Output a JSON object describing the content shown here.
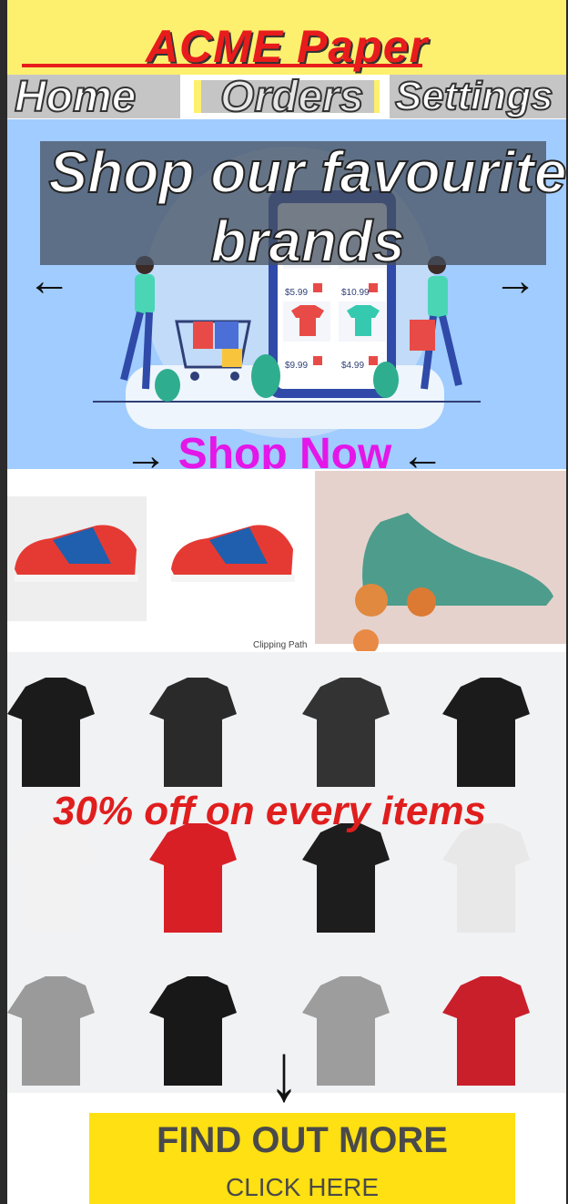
{
  "header": {
    "title": "ACME  Paper"
  },
  "nav": [
    {
      "label": "Home"
    },
    {
      "label": "Orders"
    },
    {
      "label": "Settings"
    }
  ],
  "hero": {
    "title": "Shop our favourite brands",
    "prev_arrow": "←",
    "next_arrow": "→",
    "cta_arrow_left": "→",
    "cta_arrow_right": "←",
    "cta_label": "Shop Now",
    "prices": [
      "$5.99",
      "$10.99",
      "$9.99",
      "$4.99"
    ]
  },
  "shoes": {
    "caption": "Clipping Path"
  },
  "shirts": {
    "promo": "30% off on every items"
  },
  "cta": {
    "main": "FIND OUT MORE",
    "sub": "CLICK HERE",
    "down_arrow": "↓"
  },
  "colors": {
    "header_bg": "#fdf06e",
    "title_red": "#e81c1c",
    "hero_bg": "#a0ccff",
    "shop_now": "#e416e8",
    "cta_yellow": "#ffe012"
  }
}
